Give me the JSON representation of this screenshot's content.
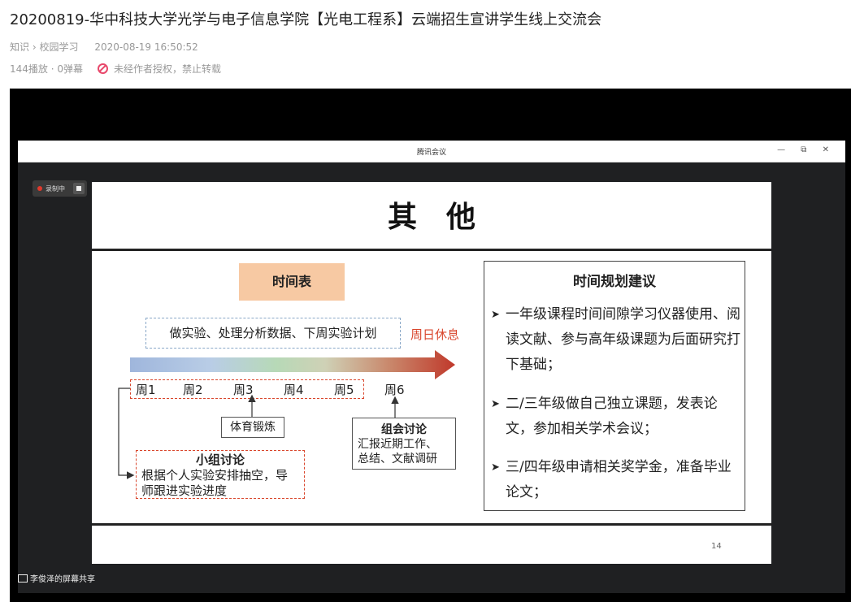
{
  "page": {
    "title": "20200819-华中科技大学光学与电子信息学院【光电工程系】云端招生宣讲学生线上交流会",
    "breadcrumb": [
      "知识",
      "校园学习"
    ],
    "breadcrumb_sep": "›",
    "date": "2020-08-19 16:50:52",
    "stats": "144播放 · 0弹幕",
    "no_auth": "未经作者授权，禁止转载"
  },
  "meeting": {
    "window_title": "腾讯会议",
    "window_controls": "— ⧉ ✕",
    "recording_label": "录制中",
    "share_label": "李俊泽的屏幕共享"
  },
  "slide": {
    "heading": "其他",
    "schedule_label": "时间表",
    "task_text": "做实验、处理分析数据、下周实验计划",
    "sunday_rest": "周日休息",
    "weeks": [
      "周1",
      "周2",
      "周3",
      "周4",
      "周5",
      "周6"
    ],
    "pe_label": "体育锻炼",
    "group_title": "组会讨论",
    "group_body": [
      "汇报近期工作、",
      "总结、文献调研"
    ],
    "small_title": "小组讨论",
    "small_body": [
      "根据个人实验安排抽空，导",
      "师跟进实验进度"
    ],
    "advice_title": "时间规划建议",
    "advice_items": [
      "一年级课程时间间隙学习仪器使用、阅读文献、参与高年级课题为后面研究打下基础；",
      "二/三年级做自己独立课题，发表论文，参加相关学术会议；",
      "三/四年级申请相关奖学金，准备毕业论文；"
    ],
    "advice_bullet": "➤",
    "page_number": "14"
  },
  "colors": {
    "accent_red": "#d9462c",
    "schedule_bg": "#f7c9a3",
    "noauth_icon": "#e8486b"
  }
}
